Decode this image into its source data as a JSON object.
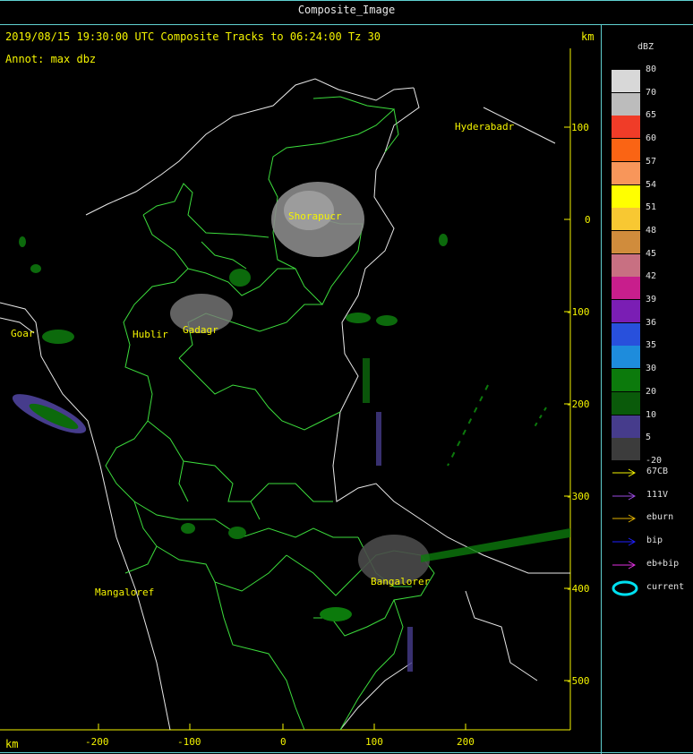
{
  "window_title": "Composite_Image",
  "header": {
    "line1": "2019/08/15 19:30:00 UTC Composite Tracks to 06:24:00 Tz 30",
    "annot": "Annot: max dbz",
    "unit_top": "km",
    "unit_bottom": "km"
  },
  "y_axis": {
    "ticks": [
      {
        "label": "100",
        "value": 100
      },
      {
        "label": "0",
        "value": 0
      },
      {
        "label": "-100",
        "value": -100
      },
      {
        "label": "-200",
        "value": -200
      },
      {
        "label": "-300",
        "value": -300
      },
      {
        "label": "-400",
        "value": -400
      },
      {
        "label": "-500",
        "value": -500
      }
    ]
  },
  "x_axis": {
    "ticks": [
      {
        "label": "-200",
        "value": -200
      },
      {
        "label": "-100",
        "value": -100
      },
      {
        "label": "0",
        "value": 0
      },
      {
        "label": "100",
        "value": 100
      },
      {
        "label": "200",
        "value": 200
      }
    ]
  },
  "cities": [
    {
      "name": "Hyderabad",
      "label": "Hyderabadr"
    },
    {
      "name": "Shorapur",
      "label": "Shorapucr"
    },
    {
      "name": "Goa",
      "label": "Goar"
    },
    {
      "name": "Hubli",
      "label": "Hublir"
    },
    {
      "name": "Gadag",
      "label": "Gadagr"
    },
    {
      "name": "Mangalore",
      "label": "Mangaloref"
    },
    {
      "name": "Bangalore",
      "label": "Bangalorer"
    }
  ],
  "legend": {
    "title": "dBZ",
    "items": [
      {
        "label": "80",
        "color": "#d8d8d8"
      },
      {
        "label": "70",
        "color": "#bcbcbc"
      },
      {
        "label": "65",
        "color": "#f03c28"
      },
      {
        "label": "60",
        "color": "#fa6414"
      },
      {
        "label": "57",
        "color": "#f8965a"
      },
      {
        "label": "54",
        "color": "#ffff00"
      },
      {
        "label": "51",
        "color": "#f8c832"
      },
      {
        "label": "48",
        "color": "#d08c3c"
      },
      {
        "label": "45",
        "color": "#c87082"
      },
      {
        "label": "42",
        "color": "#c81e8c"
      },
      {
        "label": "39",
        "color": "#7a1eb4"
      },
      {
        "label": "36",
        "color": "#2850dc"
      },
      {
        "label": "35",
        "color": "#1e8cdc"
      },
      {
        "label": "30",
        "color": "#0c7a0c"
      },
      {
        "label": "20",
        "color": "#0a5a0a"
      },
      {
        "label": "10",
        "color": "#463c8c"
      },
      {
        "label": "5",
        "color": "#3c3c3c"
      },
      {
        "label": "-20",
        "color": ""
      }
    ]
  },
  "tracks": [
    {
      "label": "67CB",
      "color": "#f4f400"
    },
    {
      "label": "111V",
      "color": "#9a4ae0"
    },
    {
      "label": "eburn",
      "color": "#e0b000"
    },
    {
      "label": "bip",
      "color": "#2020ff"
    },
    {
      "label": "eb+bip",
      "color": "#e030e0"
    },
    {
      "label": "current",
      "color": "#00e0f0"
    }
  ]
}
